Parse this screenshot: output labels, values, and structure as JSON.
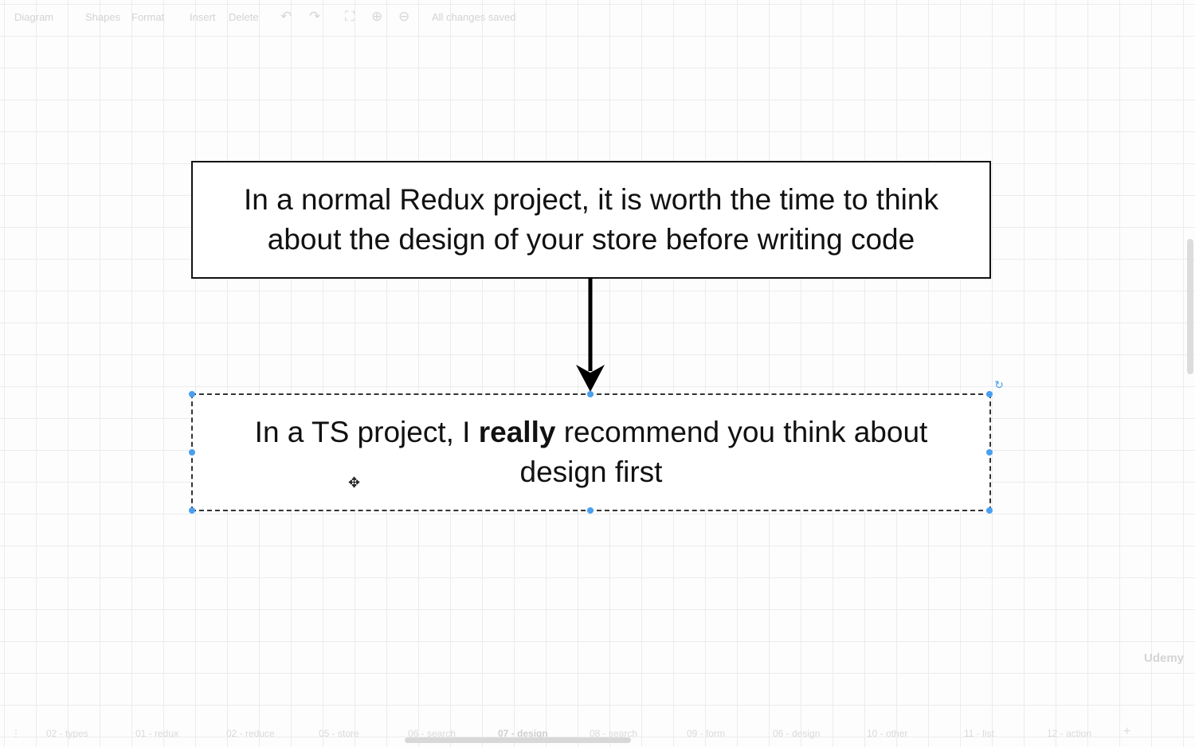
{
  "toolbar": {
    "menu_diagram": "Diagram",
    "menu_shapes": "Shapes",
    "menu_format": "Format",
    "menu_insert": "Insert",
    "menu_delete": "Delete",
    "status": "All changes saved",
    "icons": [
      "undo-icon",
      "redo-icon",
      "fullscreen-icon",
      "zoom-in-icon",
      "zoom-out-icon"
    ]
  },
  "diagram": {
    "top_box_line1": "In a normal Redux project, it is worth the time to think",
    "top_box_line2": "about the design of your store before writing code",
    "bottom_box_prefix": "In a TS project, I ",
    "bottom_box_bold": "really",
    "bottom_box_suffix": " recommend you think about",
    "bottom_box_line2": "design first"
  },
  "page_tabs": [
    "02 - types",
    "01 - redux",
    "02 - reduce",
    "05 - store",
    "06 - search",
    "07 - design",
    "08 - search",
    "09 - form",
    "06 - design",
    "10 - other",
    "11 - list",
    "12 - action"
  ],
  "active_tab": "07 - design",
  "watermark": "Udemy",
  "colors": {
    "selection": "#4a9ff0",
    "border": "#111111",
    "grid": "#ececec"
  }
}
